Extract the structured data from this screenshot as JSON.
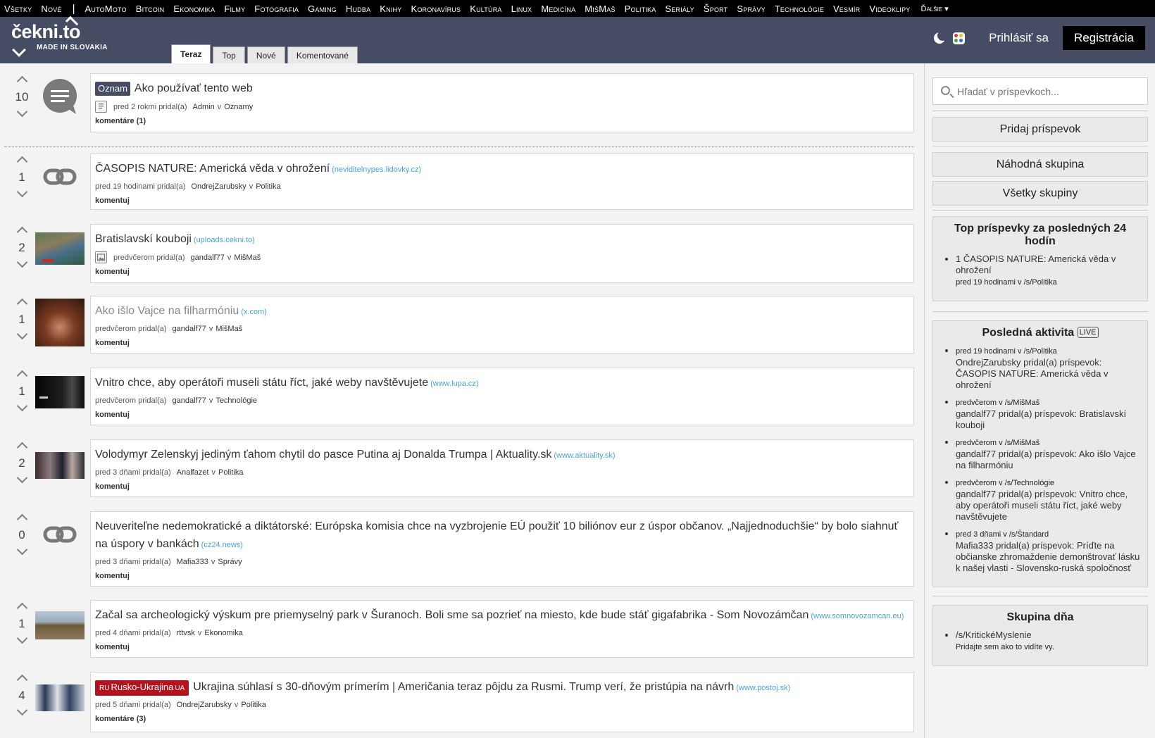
{
  "categories": [
    "Všetky",
    "Nové",
    "AutoMoto",
    "Bitcoin",
    "Ekonomika",
    "Filmy",
    "Fotografia",
    "Gaming",
    "Hudba",
    "Knihy",
    "Koronavírus",
    "Kultúra",
    "Linux",
    "Medicína",
    "MišMaš",
    "Politika",
    "Seriály",
    "Šport",
    "Správy",
    "Technológie",
    "Vesmír",
    "Videoklipy"
  ],
  "more_label": "Ďalšie ▾",
  "logo": {
    "name": "čekni.to",
    "tagline": "MADE IN SLOVAKIA"
  },
  "tabs": [
    "Teraz",
    "Top",
    "Nové",
    "Komentované"
  ],
  "header": {
    "login": "Prihlásiť sa",
    "register": "Registrácia"
  },
  "posts": [
    {
      "score": "10",
      "badge": "Oznam",
      "title": "Ako používať tento web",
      "domain": "",
      "time": "pred 2 rokmi pridal(a)",
      "author": "Admin",
      "in": "v",
      "group": "Oznamy",
      "comments": "komentáre (1)"
    },
    {
      "score": "1",
      "title": "ČASOPIS NATURE: Americká věda v ohrožení",
      "domain": "(neviditelnypes.lidovky.cz)",
      "time": "pred 19 hodinami pridal(a)",
      "author": "OndrejZarubsky",
      "in": "v",
      "group": "Politika",
      "comments": "komentuj"
    },
    {
      "score": "2",
      "title": "Bratislavskí kouboji",
      "domain": "(uploads.cekni.to)",
      "time": "predvčerom pridal(a)",
      "author": "gandalf77",
      "in": "v",
      "group": "MišMaš",
      "comments": "komentuj"
    },
    {
      "score": "1",
      "title": "Ako išlo Vajce na filharmóniu",
      "domain": "(x.com)",
      "time": "predvčerom pridal(a)",
      "author": "gandalf77",
      "in": "v",
      "group": "MišMaš",
      "comments": "komentuj"
    },
    {
      "score": "1",
      "title": "Vnitro chce, aby operátoři museli státu říct, jaké weby navštěvujete",
      "domain": "(www.lupa.cz)",
      "time": "predvčerom pridal(a)",
      "author": "gandalf77",
      "in": "v",
      "group": "Technológie",
      "comments": "komentuj"
    },
    {
      "score": "2",
      "title": "Volodymyr Zelenskyj jediným ťahom chytil do pasce Putina aj Donalda Trumpa | Aktuality.sk",
      "domain": "(www.aktuality.sk)",
      "time": "pred 3 dňami pridal(a)",
      "author": "Analfazet",
      "in": "v",
      "group": "Politika",
      "comments": "komentuj"
    },
    {
      "score": "0",
      "title": "Neuveriteľne nedemokratické a diktátorské: Európska komisia chce na vyzbrojenie EÚ použiť 10 biliónov eur z úspor občanov. „Najjednoduchšie“ by bolo siahnuť na úspory v bankách",
      "domain": "(cz24.news)",
      "time": "pred 3 dňami pridal(a)",
      "author": "Mafia333",
      "in": "v",
      "group": "Správy",
      "comments": "komentuj"
    },
    {
      "score": "1",
      "title": "Začal sa archeologický výskum pre priemyselný park v Šuranoch. Boli sme sa pozrieť na miesto, kde bude stáť gigafabrika - Som Novozámčan",
      "domain": "(www.somnovozamcan.eu)",
      "time": "pred 4 dňami pridal(a)",
      "author": "rttvsk",
      "in": "v",
      "group": "Ekonomika",
      "comments": "komentuj"
    },
    {
      "score": "4",
      "badge_pre": "RU",
      "badge": "Rusko-Ukrajina",
      "badge_post": "UA",
      "title": "Ukrajina súhlasí s 30-dňovým prímerím | Američania teraz pôjdu za Rusmi. Trump verí, že pristúpia na návrh",
      "domain": "(www.postoj.sk)",
      "time": "pred 5 dňami pridal(a)",
      "author": "OndrejZarubsky",
      "in": "v",
      "group": "Politika",
      "comments": "komentáre (3)"
    }
  ],
  "sidebar": {
    "search_placeholder": "Hľadať v príspevkoch...",
    "add_post": "Pridaj príspevok",
    "random_group": "Náhodná skupina",
    "all_groups": "Všetky skupiny",
    "top24_title": "Top príspevky za posledných 24 hodín",
    "top24": [
      {
        "text": "1 ČASOPIS NATURE: Americká věda v ohrožení",
        "meta": "pred 19 hodinami v /s/Politika"
      }
    ],
    "activity_title": "Posledná aktivita",
    "live_label": "LIVE",
    "activity": [
      {
        "meta": "pred 19 hodinami v /s/Politika",
        "text": "OndrejZarubsky pridal(a) príspevok: ČASOPIS NATURE: Americká věda v ohrožení"
      },
      {
        "meta": "predvčerom v /s/MišMaš",
        "text": "gandalf77 pridal(a) príspevok: Bratislavskí kouboji"
      },
      {
        "meta": "predvčerom v /s/MišMaš",
        "text": "gandalf77 pridal(a) príspevok: Ako išlo Vajce na filharmóniu"
      },
      {
        "meta": "predvčerom v /s/Technológie",
        "text": "gandalf77 pridal(a) príspevok: Vnitro chce, aby operátoři museli státu říct, jaké weby navštěvujete"
      },
      {
        "meta": "pred 3 dňami v /s/Štandard",
        "text": "Mafia333 pridal(a) príspevok: Príďte na občianske zhromaždenie demonštrovať lásku k našej vlasti - Slovensko-ruská spoločnosť"
      }
    ],
    "group_day_title": "Skupina dňa",
    "group_day": {
      "name": "/s/KritickéMyslenie",
      "desc": "Pridajte sem ako to vidíte vy."
    }
  }
}
